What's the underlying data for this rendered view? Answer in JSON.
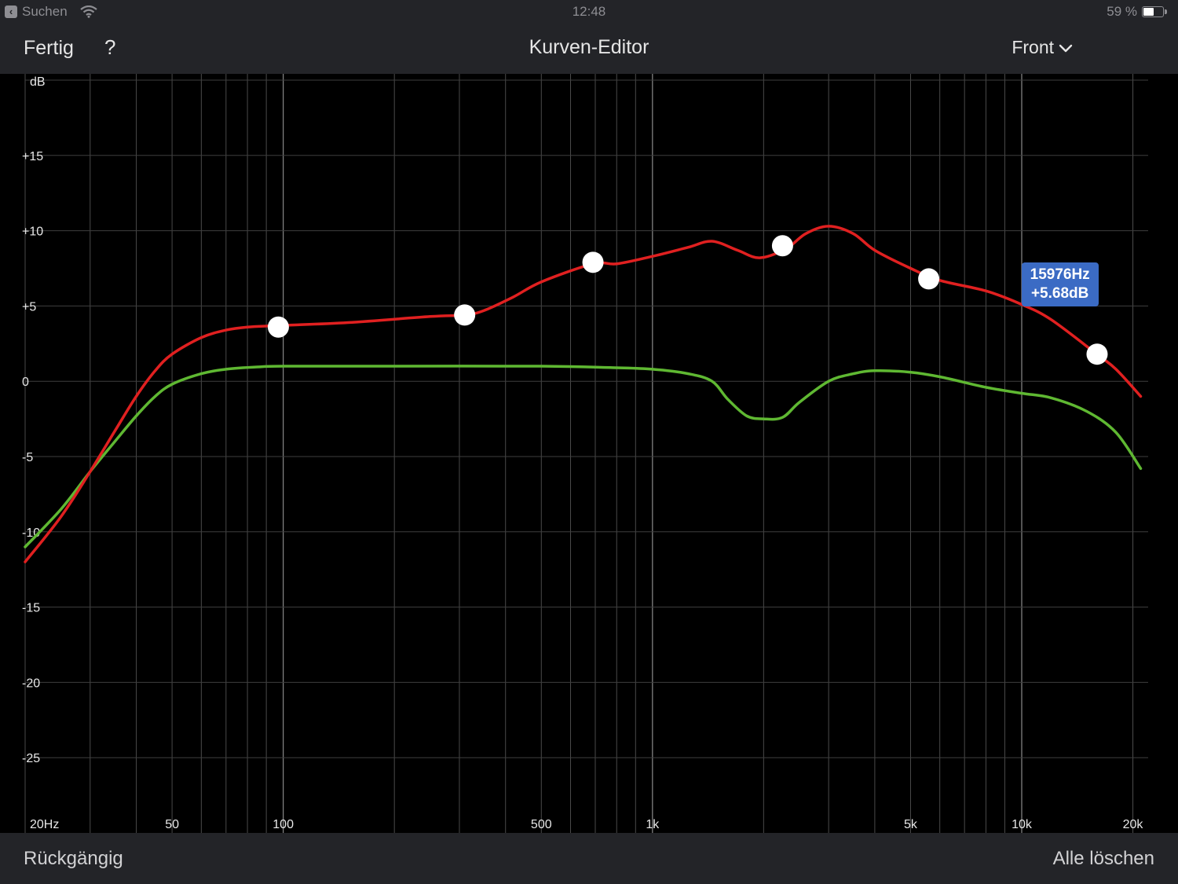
{
  "status_bar": {
    "back_label": "Suchen",
    "time": "12:48",
    "battery_text": "59 %",
    "battery_level": 0.59
  },
  "nav": {
    "done_label": "Fertig",
    "help_label": "?",
    "title": "Kurven-Editor",
    "channel_label": "Front"
  },
  "toolbar": {
    "undo_label": "Rückgängig",
    "clear_label": "Alle löschen"
  },
  "tooltip": {
    "freq": "15976Hz",
    "gain": "+5.68dB",
    "anchor_hz": 15976,
    "anchor_db": 5.68
  },
  "colors": {
    "target_curve": "#e02020",
    "measured_curve": "#5fb832",
    "grid": "#3a3a3a",
    "tooltip": "#3b6bc4",
    "bar_background": "#232428"
  },
  "chart_data": {
    "type": "line",
    "x_scale": "log",
    "xlim": [
      20,
      22000
    ],
    "ylim": [
      -30,
      20
    ],
    "y_unit_label": "dB",
    "y_ticks": [
      15,
      10,
      5,
      0,
      -5,
      -10,
      -15,
      -20,
      -25
    ],
    "y_tick_labels": [
      "+15",
      "+10",
      "+5",
      "0",
      "-5",
      "-10",
      "-15",
      "-20",
      "-25"
    ],
    "x_tick_labels": [
      {
        "hz": 20,
        "label": "20Hz"
      },
      {
        "hz": 50,
        "label": "50"
      },
      {
        "hz": 100,
        "label": "100"
      },
      {
        "hz": 500,
        "label": "500"
      },
      {
        "hz": 1000,
        "label": "1k"
      },
      {
        "hz": 5000,
        "label": "5k"
      },
      {
        "hz": 10000,
        "label": "10k"
      },
      {
        "hz": 20000,
        "label": "20k"
      }
    ],
    "grid": true,
    "series": [
      {
        "color": "#e02020",
        "x": [
          20,
          25,
          30,
          35,
          40,
          45,
          50,
          60,
          70,
          80,
          97,
          150,
          250,
          310,
          350,
          420,
          500,
          690,
          800,
          1000,
          1250,
          1450,
          1700,
          1950,
          2300,
          2600,
          3000,
          3500,
          4000,
          5000,
          6000,
          8000,
          10000,
          12000,
          15976,
          18000,
          21000
        ],
        "y": [
          -12,
          -9,
          -6,
          -3.3,
          -1,
          0.7,
          1.8,
          2.9,
          3.4,
          3.6,
          3.7,
          3.9,
          4.3,
          4.4,
          4.7,
          5.6,
          6.6,
          7.8,
          7.8,
          8.3,
          8.9,
          9.3,
          8.7,
          8.2,
          8.8,
          9.8,
          10.3,
          9.8,
          8.7,
          7.5,
          6.7,
          6.0,
          5.1,
          4.1,
          1.8,
          0.8,
          -1
        ]
      },
      {
        "color": "#5fb832",
        "x": [
          20,
          25,
          30,
          35,
          40,
          45,
          50,
          60,
          70,
          85,
          100,
          200,
          500,
          800,
          1000,
          1250,
          1450,
          1600,
          1800,
          2000,
          2250,
          2500,
          3000,
          3500,
          4000,
          5000,
          6000,
          8000,
          10000,
          12000,
          15000,
          18000,
          21000
        ],
        "y": [
          -11,
          -8.5,
          -6,
          -4,
          -2.3,
          -1,
          -0.2,
          0.5,
          0.8,
          0.95,
          1,
          1,
          1,
          0.9,
          0.8,
          0.5,
          0,
          -1.2,
          -2.3,
          -2.5,
          -2.4,
          -1.4,
          0,
          0.5,
          0.7,
          0.6,
          0.3,
          -0.4,
          -0.8,
          -1.1,
          -2,
          -3.4,
          -5.8
        ]
      }
    ],
    "control_points": [
      {
        "hz": 97,
        "db": 3.6
      },
      {
        "hz": 310,
        "db": 4.4
      },
      {
        "hz": 690,
        "db": 7.9
      },
      {
        "hz": 2250,
        "db": 9.0
      },
      {
        "hz": 5600,
        "db": 6.8
      },
      {
        "hz": 16000,
        "db": 1.8
      }
    ]
  }
}
